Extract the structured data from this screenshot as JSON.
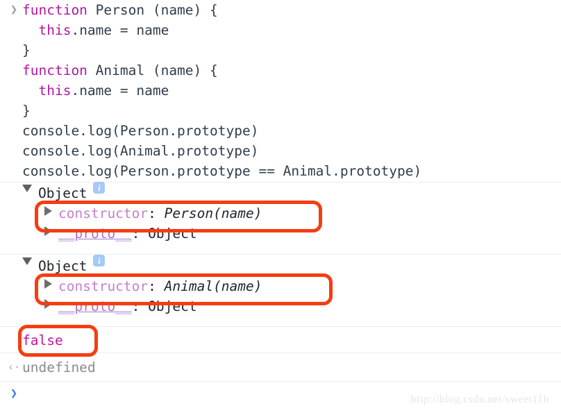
{
  "console": {
    "input_prompt_glyph": "❯",
    "output_prompt_glyph": "‹·",
    "live_prompt_glyph": "❯",
    "source_lines": [
      [
        {
          "t": "kw",
          "v": "function"
        },
        {
          "t": "plain",
          "v": " Person (name) {"
        }
      ],
      [
        {
          "t": "plain",
          "v": "  "
        },
        {
          "t": "kw",
          "v": "this"
        },
        {
          "t": "plain",
          "v": ".name = name"
        }
      ],
      [
        {
          "t": "plain",
          "v": "}"
        }
      ],
      [
        {
          "t": "kw",
          "v": "function"
        },
        {
          "t": "plain",
          "v": " Animal (name) {"
        }
      ],
      [
        {
          "t": "plain",
          "v": "  "
        },
        {
          "t": "kw",
          "v": "this"
        },
        {
          "t": "plain",
          "v": ".name = name"
        }
      ],
      [
        {
          "t": "plain",
          "v": "}"
        }
      ],
      [
        {
          "t": "plain",
          "v": "console.log(Person.prototype)"
        }
      ],
      [
        {
          "t": "plain",
          "v": "console.log(Animal.prototype)"
        }
      ],
      [
        {
          "t": "plain",
          "v": "console.log(Person.prototype == Animal.prototype)"
        }
      ]
    ],
    "groups": [
      {
        "label": "Object",
        "info_glyph": "i",
        "properties": [
          {
            "name": "constructor",
            "value": "Person(name)",
            "kind": "ctor"
          },
          {
            "name": "__proto__",
            "value": "Object",
            "kind": "proto"
          }
        ]
      },
      {
        "label": "Object",
        "info_glyph": "i",
        "properties": [
          {
            "name": "constructor",
            "value": "Animal(name)",
            "kind": "ctor"
          },
          {
            "name": "__proto__",
            "value": "Object",
            "kind": "proto"
          }
        ]
      }
    ],
    "bool_result": "false",
    "eval_result": "undefined",
    "watermark": "http://blog.csdn.net/sweet11h",
    "colors": {
      "keyword": "#b3179e",
      "code": "#2f3d4c",
      "property_constructor": "#c57fd0",
      "property_proto": "#ab72c4",
      "boolean": "#c2169c",
      "undefined": "#8c8c8c",
      "annotation": "#f53d12",
      "info_badge": "#a6c8fa",
      "live_prompt": "#3b78e7",
      "divider": "#ececec"
    }
  }
}
